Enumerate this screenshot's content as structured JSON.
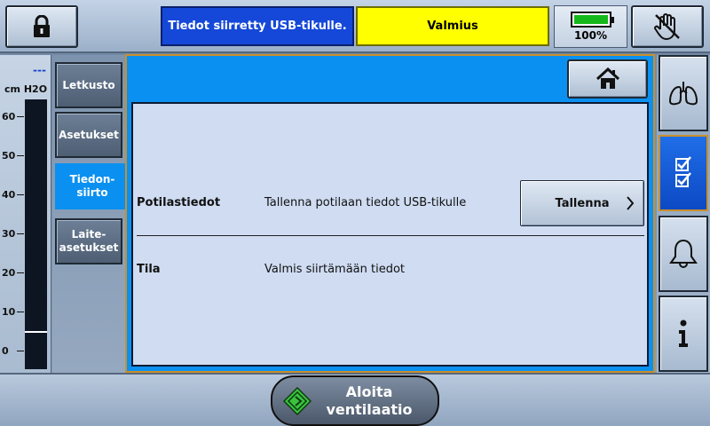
{
  "status": {
    "message_primary": "Tiedot siirretty USB-tikulle.",
    "message_secondary": "Valmius",
    "battery_percent_text": "100%",
    "battery_level": 1.0
  },
  "gauge": {
    "dash": "---",
    "unit_cm": "cm",
    "unit_h2o": "H2O",
    "ticks": [
      "60",
      "50",
      "40",
      "30",
      "20",
      "10",
      "0"
    ],
    "current_value": 5
  },
  "tabs": [
    {
      "label_lines": [
        "Letkusto"
      ],
      "active": false
    },
    {
      "label_lines": [
        "Asetukset"
      ],
      "active": false
    },
    {
      "label_lines": [
        "Tiedon-",
        "siirto"
      ],
      "active": true
    },
    {
      "label_lines": [
        "Laite-",
        "asetukset"
      ],
      "active": false
    }
  ],
  "panel": {
    "row1_label": "Potilastiedot",
    "row1_text": "Tallenna potilaan tiedot USB-tikulle",
    "save_label": "Tallenna",
    "row2_label": "Tila",
    "row2_text": "Valmis siirtämään tiedot"
  },
  "bottom": {
    "start_line1": "Aloita",
    "start_line2": "ventilaatio"
  },
  "colors": {
    "accent_blue": "#0a90f0",
    "message_blue": "#1548d8",
    "message_yellow": "#ffff00",
    "battery_green": "#15b81a",
    "active_frame": "#c8902c"
  },
  "icons": {
    "lock": "lock-icon",
    "hand": "stop-hand-icon",
    "home": "home-icon",
    "lungs": "lungs-icon",
    "checklist": "checklist-icon",
    "alarm": "alarm-bell-icon",
    "info": "info-icon",
    "start": "start-diamond-icon"
  }
}
